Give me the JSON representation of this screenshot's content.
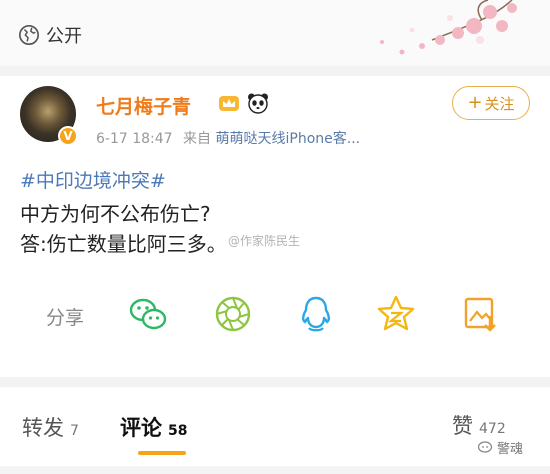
{
  "visibility": {
    "label": "公开",
    "icon": "globe-icon"
  },
  "post": {
    "author": {
      "name": "七月梅子青",
      "badges": [
        "crown-icon",
        "panda-icon"
      ],
      "verified": "V"
    },
    "time": "6-17 18:47",
    "source_prefix": "来自",
    "source": "萌萌哒天线iPhone客...",
    "follow_label": "关注",
    "hashtag": "#中印边境冲突#",
    "line1": "中方为何不公布伤亡?",
    "line2": "答:伤亡数量比阿三多。",
    "watermark": "@作家陈民生"
  },
  "share": {
    "label": "分享",
    "targets": [
      "wechat-icon",
      "moments-icon",
      "qq-icon",
      "qzone-icon",
      "save-image-icon"
    ]
  },
  "tabs": [
    {
      "label": "转发",
      "count": "7"
    },
    {
      "label": "评论",
      "count": "58"
    },
    {
      "label": "赞",
      "count": "472"
    }
  ],
  "source_mark": "警魂",
  "colors": {
    "accent": "#f7a21b",
    "link": "#4d79b8",
    "username": "#f07b1a"
  }
}
